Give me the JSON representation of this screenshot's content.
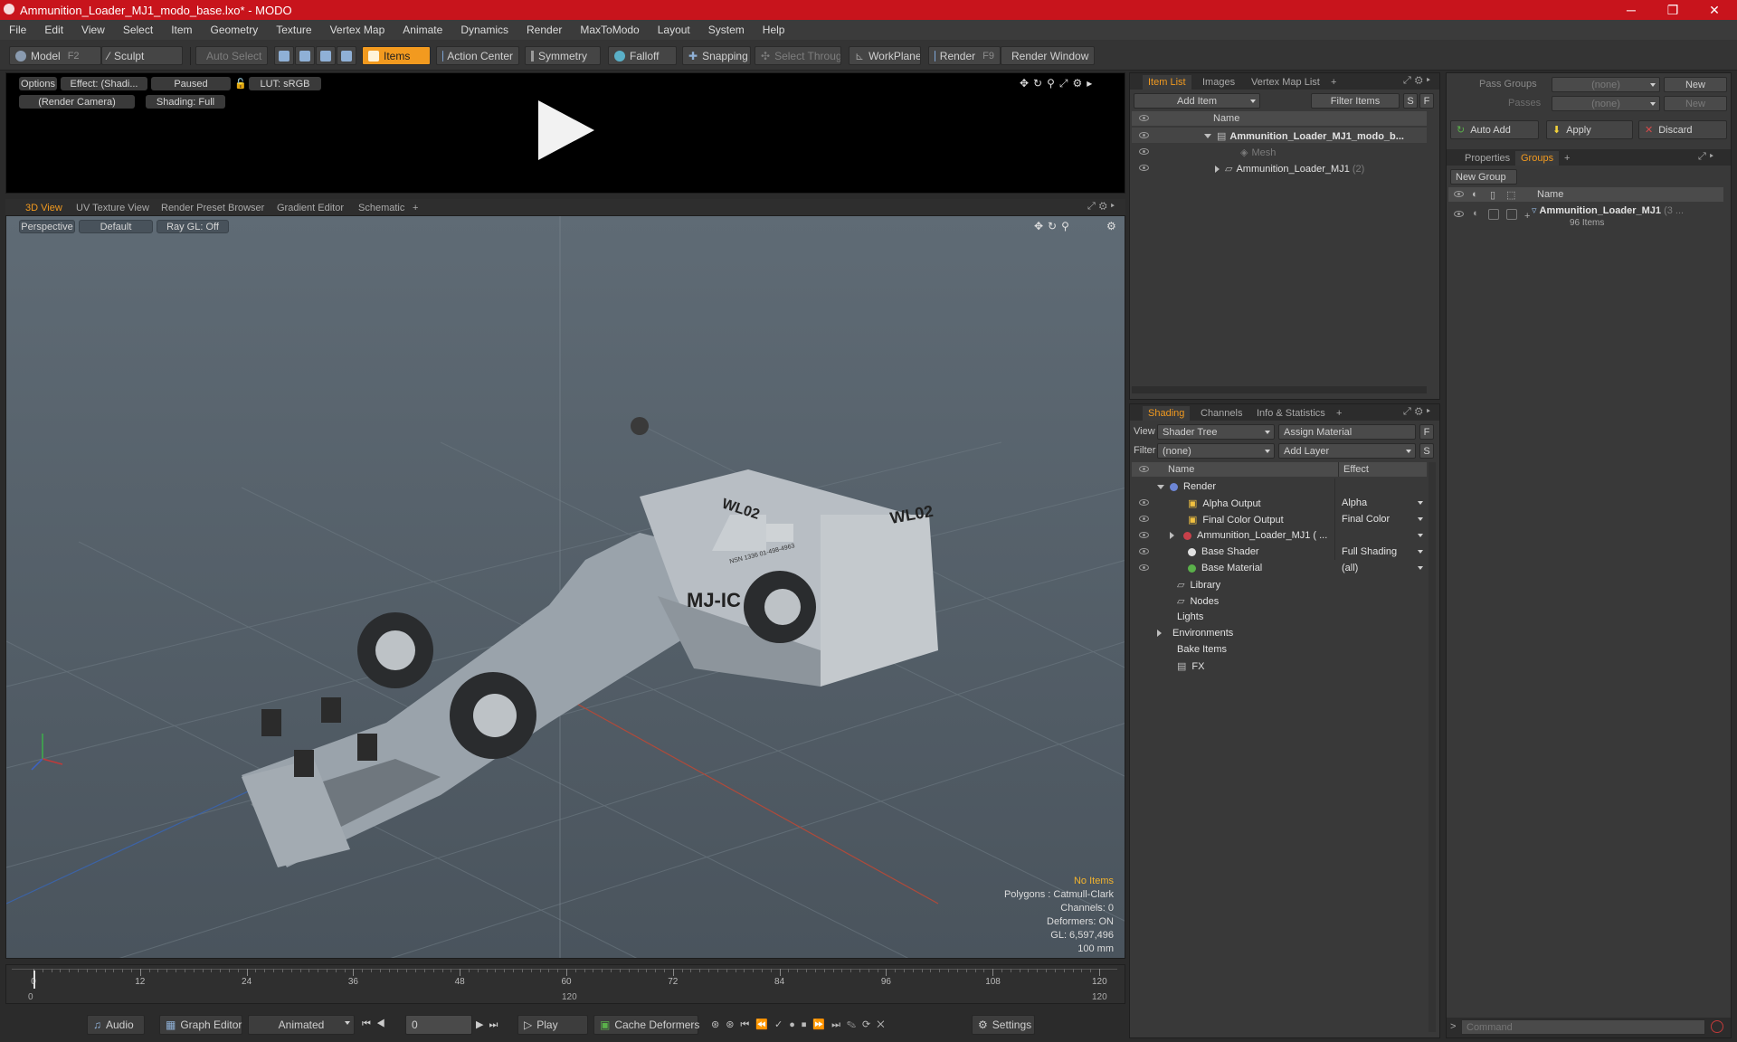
{
  "window": {
    "title": "Ammunition_Loader_MJ1_modo_base.lxo* - MODO",
    "minimize": "─",
    "maximize": "❐",
    "close": "✕"
  },
  "menu": [
    "File",
    "Edit",
    "View",
    "Select",
    "Item",
    "Geometry",
    "Texture",
    "Vertex Map",
    "Animate",
    "Dynamics",
    "Render",
    "MaxToModo",
    "Layout",
    "System",
    "Help"
  ],
  "toolbar": {
    "model": "Model",
    "model_key": "F2",
    "sculpt": "Sculpt",
    "auto_select": "Auto Select",
    "items": "Items",
    "action_center": "Action Center",
    "symmetry": "Symmetry",
    "falloff": "Falloff",
    "snapping": "Snapping",
    "select_through": "Select Through",
    "workplane": "WorkPlane",
    "render": "Render",
    "render_key": "F9",
    "render_window": "Render Window"
  },
  "render_preview": {
    "options": "Options",
    "effect": "Effect: (Shadi...",
    "paused": "Paused",
    "lut": "LUT: sRGB",
    "camera": "(Render Camera)",
    "shading": "Shading: Full"
  },
  "view_tabs": [
    "3D View",
    "UV Texture View",
    "Render Preset Browser",
    "Gradient Editor",
    "Schematic",
    "+"
  ],
  "viewport": {
    "perspective": "Perspective",
    "default": "Default",
    "raygl": "Ray GL: Off",
    "info": {
      "no_items": "No Items",
      "polygons": "Polygons : Catmull-Clark",
      "channels": "Channels: 0",
      "deformers": "Deformers: ON",
      "gl": "GL: 6,597,496",
      "scale": "100 mm"
    },
    "decals": {
      "front": "MJ-IC",
      "side": "WL02",
      "hood": "WL02",
      "serial": "NSN 1336 01-498-4963"
    }
  },
  "timeline": {
    "ticks": [
      "0",
      "12",
      "24",
      "36",
      "48",
      "60",
      "72",
      "84",
      "96",
      "108",
      "120"
    ],
    "start": "0",
    "end": "120",
    "end2": "120"
  },
  "bottom": {
    "audio": "Audio",
    "graph_editor": "Graph Editor",
    "animated": "Animated",
    "frame": "0",
    "play": "Play",
    "cache_deformers": "Cache Deformers",
    "settings": "Settings"
  },
  "item_list": {
    "tabs": [
      "Item List",
      "Images",
      "Vertex Map List",
      "+"
    ],
    "add_item": "Add Item",
    "filter": "Filter Items",
    "s": "S",
    "f": "F",
    "col_name": "Name",
    "rows": [
      {
        "label": "Ammunition_Loader_MJ1_modo_b...",
        "suffix": ""
      },
      {
        "label": "Mesh",
        "suffix": ""
      },
      {
        "label": "Ammunition_Loader_MJ1",
        "suffix": "(2)"
      }
    ]
  },
  "shading": {
    "tabs": [
      "Shading",
      "Channels",
      "Info & Statistics",
      "+"
    ],
    "view_label": "View",
    "view_value": "Shader Tree",
    "assign_material": "Assign Material",
    "filter_label": "Filter",
    "filter_value": "(none)",
    "add_layer": "Add Layer",
    "f": "F",
    "s": "S",
    "col_name": "Name",
    "col_effect": "Effect",
    "rows": [
      {
        "label": "Render",
        "effect": ""
      },
      {
        "label": "Alpha Output",
        "effect": "Alpha"
      },
      {
        "label": "Final Color Output",
        "effect": "Final Color"
      },
      {
        "label": "Ammunition_Loader_MJ1 ( ...",
        "effect": ""
      },
      {
        "label": "Base Shader",
        "effect": "Full Shading"
      },
      {
        "label": "Base Material",
        "effect": "(all)"
      },
      {
        "label": "Library",
        "effect": ""
      },
      {
        "label": "Nodes",
        "effect": ""
      },
      {
        "label": "Lights",
        "effect": ""
      },
      {
        "label": "Environments",
        "effect": ""
      },
      {
        "label": "Bake Items",
        "effect": ""
      },
      {
        "label": "FX",
        "effect": ""
      }
    ]
  },
  "groups_panel": {
    "pass_groups": "Pass Groups",
    "pass_value": "(none)",
    "new": "New",
    "passes": "Passes",
    "passes_value": "(none)",
    "new2": "New",
    "auto_add": "Auto Add",
    "apply": "Apply",
    "discard": "Discard",
    "tabs": [
      "Properties",
      "Groups",
      "+"
    ],
    "new_group": "New Group",
    "col_name": "Name",
    "group_name": "Ammunition_Loader_MJ1",
    "group_suffix": "(3 ...",
    "group_count": "96 Items"
  },
  "command": {
    "placeholder": "Command",
    "arrow": ">"
  }
}
